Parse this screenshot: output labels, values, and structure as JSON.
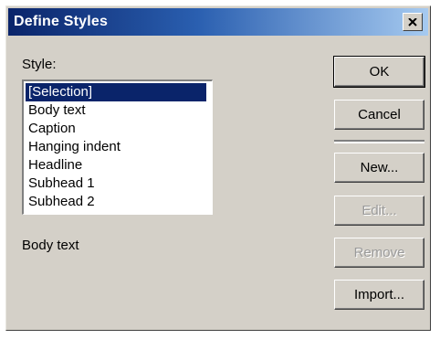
{
  "window": {
    "title": "Define Styles",
    "close_icon": "close-icon"
  },
  "style_section": {
    "label": "Style:",
    "items": [
      {
        "label": "[Selection]",
        "selected": true
      },
      {
        "label": "Body text",
        "selected": false
      },
      {
        "label": "Caption",
        "selected": false
      },
      {
        "label": "Hanging indent",
        "selected": false
      },
      {
        "label": "Headline",
        "selected": false
      },
      {
        "label": "Subhead 1",
        "selected": false
      },
      {
        "label": "Subhead 2",
        "selected": false
      }
    ],
    "description": "Body text"
  },
  "buttons": {
    "ok": {
      "label": "OK",
      "enabled": true
    },
    "cancel": {
      "label": "Cancel",
      "enabled": true
    },
    "new": {
      "label": "New...",
      "enabled": true
    },
    "edit": {
      "label": "Edit...",
      "enabled": false
    },
    "remove": {
      "label": "Remove",
      "enabled": false
    },
    "import": {
      "label": "Import...",
      "enabled": true
    }
  },
  "colors": {
    "title_bar": "#0a246a",
    "selection_highlight": "#0a246a",
    "dialog_face": "#d4d0c8"
  }
}
